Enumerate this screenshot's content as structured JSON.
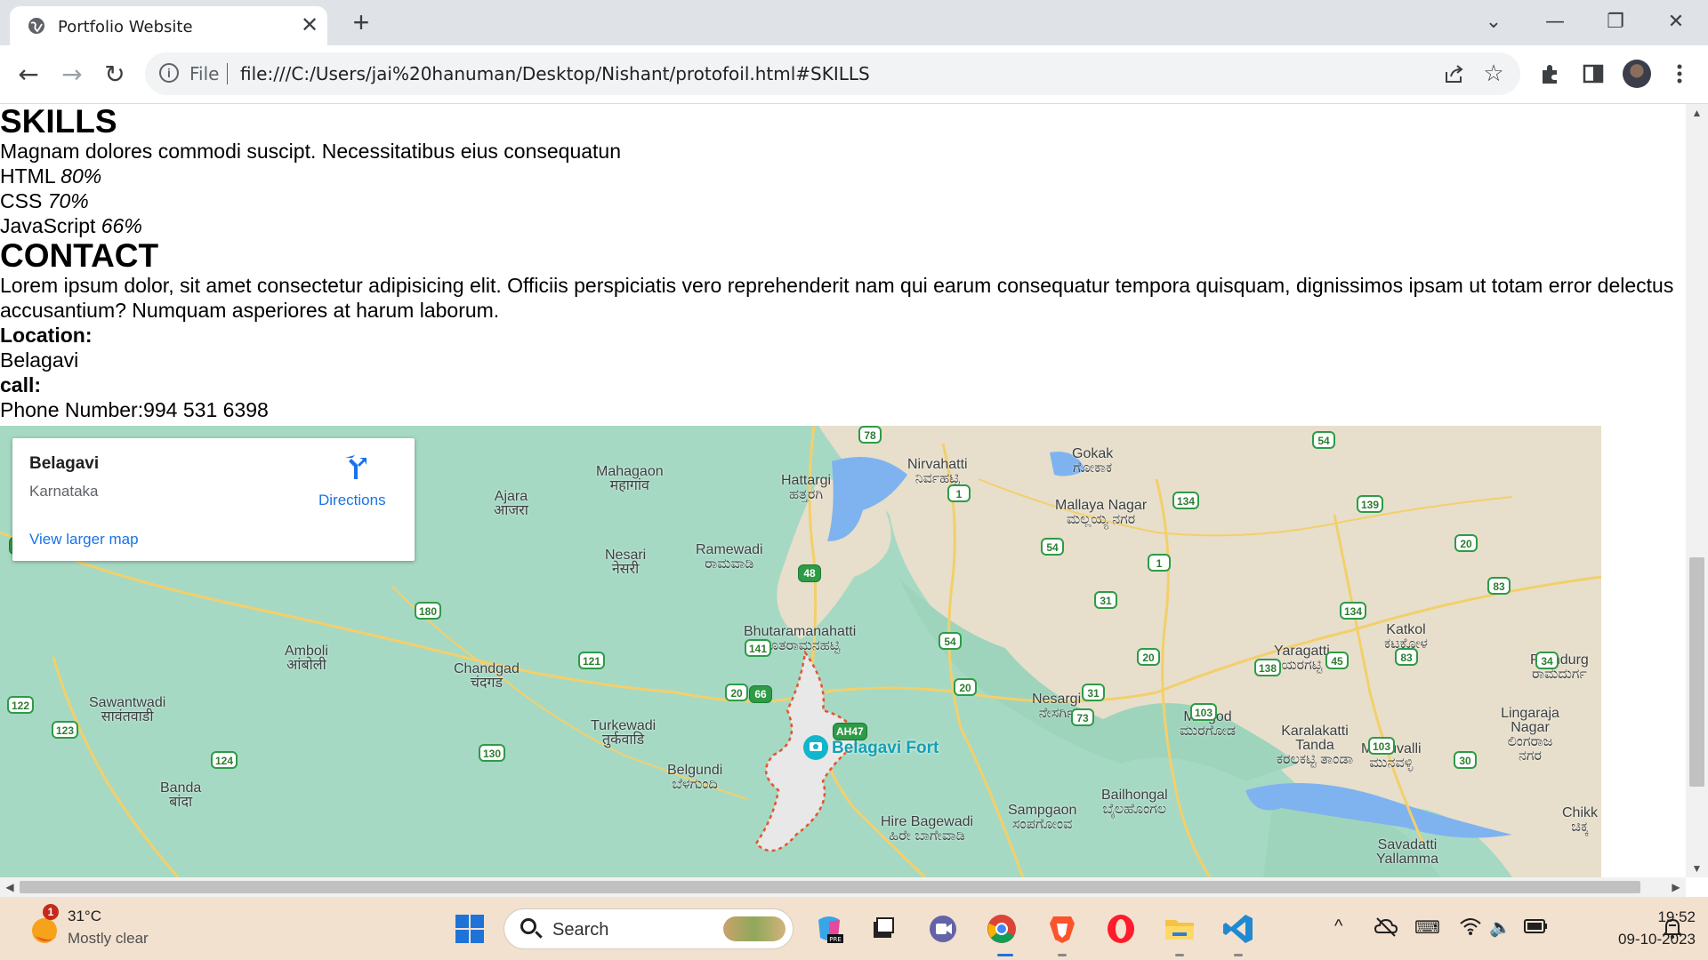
{
  "browser": {
    "tab_title": "Portfolio Website",
    "tab_close": "✕",
    "new_tab": "+",
    "url_scheme": "File",
    "url": "file:///C:/Users/jai%20hanuman/Desktop/Nishant/protofoil.html#SKILLS",
    "window_controls": {
      "tab_search": "⌄",
      "minimize": "—",
      "restore": "❐",
      "close": "✕"
    },
    "nav": {
      "back": "←",
      "forward": "→",
      "reload": "↻"
    }
  },
  "page": {
    "skills_heading": "SKILLS",
    "skills_intro": "Magnam dolores commodi suscipt. Necessitatibus eius consequatun",
    "skills": [
      {
        "name": "HTML",
        "level": "80%"
      },
      {
        "name": "CSS",
        "level": "70%"
      },
      {
        "name": "JavaScript",
        "level": "66%"
      }
    ],
    "contact_heading": "CONTACT",
    "contact_text": "Lorem ipsum dolor, sit amet consectetur adipisicing elit. Officiis perspiciatis vero reprehenderit nam qui earum consequatur tempora quisquam, dignissimos ipsam ut totam error delectus accusantium? Numquam asperiores at harum laborum.",
    "location_label": "Location:",
    "location_value": "Belagavi",
    "call_label": "call:",
    "phone": "Phone Number:994 531 6398"
  },
  "map": {
    "card": {
      "place": "Belagavi",
      "region": "Karnataka",
      "directions": "Directions",
      "larger_map": "View larger map"
    },
    "poi": "Belagavi Fort",
    "labels": [
      {
        "id": "mahagaon",
        "text": "Mahagaon",
        "local": "महागांव"
      },
      {
        "id": "hattargi",
        "text": "Hattargi",
        "local": "ಹತ್ತರಗಿ"
      },
      {
        "id": "nirvahatti",
        "text": "Nirvahatti",
        "local": "ನಿರ್ವಹಟ್ಟಿ"
      },
      {
        "id": "gokak",
        "text": "Gokak",
        "local": "ಗೋಕಾಕ"
      },
      {
        "id": "mallaya",
        "text": "Mallaya Nagar",
        "local": "ಮಲ್ಲಯ್ಯ ನಗರ"
      },
      {
        "id": "ajara",
        "text": "Ajara",
        "local": "आजरा"
      },
      {
        "id": "nesari",
        "text": "Nesari",
        "local": "नेसरी"
      },
      {
        "id": "ramewadi",
        "text": "Ramewadi",
        "local": "ರಾಮವಾಡಿ"
      },
      {
        "id": "bhutara",
        "text": "Bhutaramanahatti",
        "local": "ಭೂತರಾಮನಹಟ್ಟಿ"
      },
      {
        "id": "amboli",
        "text": "Amboli",
        "local": "आंबोली"
      },
      {
        "id": "chandgad",
        "text": "Chandgad",
        "local": "चंदगड"
      },
      {
        "id": "sawantwadi",
        "text": "Sawantwadi",
        "local": "सावंतवाडी"
      },
      {
        "id": "turkewadi",
        "text": "Turkewadi",
        "local": "तुर्कवाडि"
      },
      {
        "id": "belgundi",
        "text": "Belgundi",
        "local": "ಬೆಳಗುಂದಿ"
      },
      {
        "id": "banda",
        "text": "Banda",
        "local": "बांदा"
      },
      {
        "id": "hirebag",
        "text": "Hire Bagewadi",
        "local": "ಹಿರೇ ಬಾಗೇವಾಡಿ"
      },
      {
        "id": "sampgaon",
        "text": "Sampgaon",
        "local": "ಸಂಪಗೋಂವ"
      },
      {
        "id": "bailhongal",
        "text": "Bailhongal",
        "local": "ಬೈಲಹೊಂಗಲ"
      },
      {
        "id": "nesargi",
        "text": "Nesargi",
        "local": "ನೇಸರ್ಗಿ"
      },
      {
        "id": "murgod",
        "text": "Murgod",
        "local": "ಮುರಗೋಡ"
      },
      {
        "id": "karalakatti",
        "text": "Karalakatti Tanda",
        "local": "ಕರಲಕಟ್ಟಿ ತಾಂಡಾ"
      },
      {
        "id": "munuvalli",
        "text": "Munuvalli",
        "local": "ಮುನವಳ್ಳಿ"
      },
      {
        "id": "yaragatti",
        "text": "Yaragatti",
        "local": "ಯರಗಟ್ಟಿ"
      },
      {
        "id": "katkol",
        "text": "Katkol",
        "local": "ಕಟಕೋಳ"
      },
      {
        "id": "ramdurg",
        "text": "Ramdurg",
        "local": "ರಾಮದುರ್ಗ"
      },
      {
        "id": "lingaraja",
        "text": "Lingaraja Nagar",
        "local": "ಲಿಂಗರಾಜ ನಗರ"
      },
      {
        "id": "savadatti",
        "text": "Savadatti Yallamma",
        "local": ""
      },
      {
        "id": "chikk",
        "text": "Chikk",
        "local": "ಚಿಕ್ಕ"
      }
    ],
    "shields": [
      "78",
      "1",
      "54",
      "134",
      "139",
      "20",
      "48",
      "54",
      "1",
      "31",
      "141",
      "54",
      "20",
      "138",
      "45",
      "83",
      "34",
      "83",
      "134",
      "121",
      "20",
      "20",
      "31",
      "103",
      "73",
      "103",
      "30",
      "180",
      "66",
      "122",
      "123",
      "124",
      "130",
      "AH47",
      "66"
    ]
  },
  "taskbar": {
    "weather_badge": "1",
    "temperature": "31°C",
    "condition": "Mostly clear",
    "search_label": "Search",
    "time": "19:52",
    "date": "09-10-2023",
    "tray": {
      "chevron": "^",
      "keyboard": "⌨",
      "wifi": "◠",
      "volume": "🔈",
      "battery": "▭"
    }
  }
}
